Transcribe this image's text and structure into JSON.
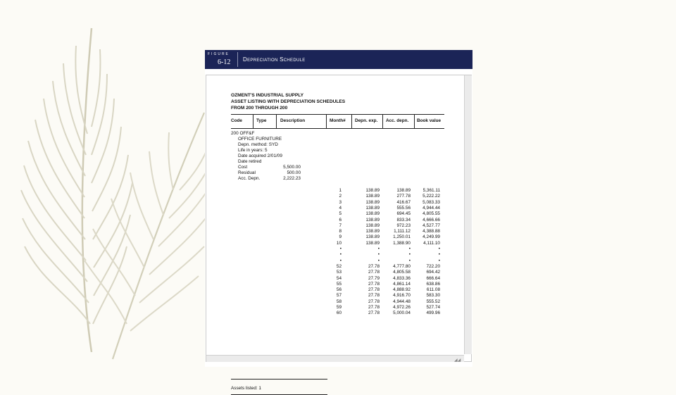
{
  "figure": {
    "label": "FIGURE",
    "number": "6-12",
    "title": "Depreciation Schedule",
    "header_color": "#1b2457"
  },
  "report": {
    "company": "OZMENT'S INDUSTRIAL SUPPLY",
    "subtitle": "ASSET LISTING WITH DEPRECIATION SCHEDULES",
    "range": "FROM 200 THROUGH 200",
    "columns": {
      "code": "Code",
      "type": "Type",
      "description": "Description",
      "month": "Month#",
      "depn_exp": "Depn. exp.",
      "acc_depn": "Acc. depn.",
      "book_value": "Book value"
    },
    "asset": {
      "code_type": "200      OFF&F",
      "description": "OFFICE FURNITURE",
      "method": "Depn. method:  SYD",
      "life": "Life in years:  5",
      "acquired": "Date acquired 2/01/09",
      "retired": "Date retired",
      "cost_label": "Cost",
      "cost_value": "5,500.00",
      "residual_label": "Residual",
      "residual_value": "500.00",
      "acc_label": "Acc. Depn.",
      "acc_value": "2,222.23"
    },
    "rows": [
      [
        "1",
        "138.89",
        "138.89",
        "5,361.11"
      ],
      [
        "2",
        "138.89",
        "277.78",
        "5,222.22"
      ],
      [
        "3",
        "138.89",
        "416.67",
        "5,083.33"
      ],
      [
        "4",
        "138.89",
        "555.56",
        "4,944.44"
      ],
      [
        "5",
        "138.89",
        "694.45",
        "4,805.55"
      ],
      [
        "6",
        "138.89",
        "833.34",
        "4,666.66"
      ],
      [
        "7",
        "138.89",
        "972.23",
        "4,527.77"
      ],
      [
        "8",
        "138.89",
        "1,111.12",
        "4,388.88"
      ],
      [
        "9",
        "138.89",
        "1,250.01",
        "4,249.99"
      ],
      [
        "10",
        "138.89",
        "1,388.90",
        "4,111.10"
      ],
      [
        "•",
        "•",
        "•",
        "•"
      ],
      [
        "•",
        "•",
        "•",
        "•"
      ],
      [
        "•",
        "•",
        "•",
        "•"
      ],
      [
        "52",
        "27.78",
        "4,777.80",
        "722.20"
      ],
      [
        "53",
        "27.78",
        "4,805.58",
        "694.42"
      ],
      [
        "54",
        "27.79",
        "4,833.36",
        "666.64"
      ],
      [
        "55",
        "27.78",
        "4,861.14",
        "638.86"
      ],
      [
        "56",
        "27.78",
        "4,888.92",
        "611.08"
      ],
      [
        "57",
        "27.78",
        "4,916.70",
        "583.30"
      ],
      [
        "58",
        "27.78",
        "4,944.48",
        "555.52"
      ],
      [
        "59",
        "27.78",
        "4,972.26",
        "527.74"
      ],
      [
        "60",
        "27.78",
        "5,000.04",
        "499.96"
      ]
    ],
    "assets_listed": "Assets listed:  1"
  }
}
